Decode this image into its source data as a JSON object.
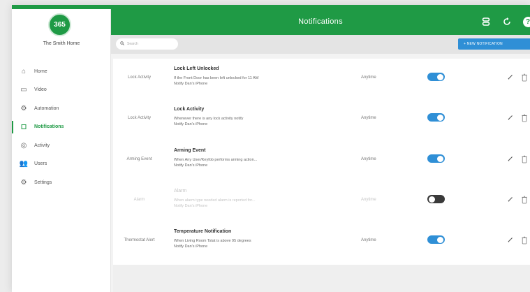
{
  "app": {
    "logo_text": "365",
    "home_name": "The Smith Home"
  },
  "sidebar": {
    "items": [
      {
        "label": "Home",
        "icon": "home-icon",
        "glyph": "⌂"
      },
      {
        "label": "Video",
        "icon": "video-icon",
        "glyph": "▭"
      },
      {
        "label": "Automation",
        "icon": "automation-icon",
        "glyph": "⚙"
      },
      {
        "label": "Notifications",
        "icon": "notifications-icon",
        "glyph": "◻"
      },
      {
        "label": "Activity",
        "icon": "activity-icon",
        "glyph": "◎"
      },
      {
        "label": "Users",
        "icon": "users-icon",
        "glyph": "👥"
      },
      {
        "label": "Settings",
        "icon": "settings-icon",
        "glyph": "⚙"
      }
    ],
    "active": "Notifications"
  },
  "header": {
    "title": "Notifications"
  },
  "toolbar": {
    "search_placeholder": "Search",
    "new_button": "+ NEW NOTIFICATION"
  },
  "notifications": [
    {
      "category": "Lock Activity",
      "title": "Lock Left Unlocked",
      "line1": "If the Front Door has been left unlocked for 11 AM",
      "line2": "Notify Dan's iPhone",
      "when": "Anytime",
      "enabled": true
    },
    {
      "category": "Lock Activity",
      "title": "Lock Activity",
      "line1": "Whenever there is any lock activity notify",
      "line2": "Notify Dan's iPhone",
      "when": "Anytime",
      "enabled": true
    },
    {
      "category": "Arming Event",
      "title": "Arming Event",
      "line1": "When Any User/Keyfob performs arming action...",
      "line2": "Notify Dan's iPhone",
      "when": "Anytime",
      "enabled": true
    },
    {
      "category": "Alarm",
      "title": "Alarm",
      "line1": "When alarm type needed alarm is reported for...",
      "line2": "Notify Dan's iPhone",
      "when": "Anytime",
      "enabled": false
    },
    {
      "category": "Thermostat Alert",
      "title": "Temperature Notification",
      "line1": "When Living Room Tstat is above 95 degrees",
      "line2": "Notify Dan's iPhone",
      "when": "Anytime",
      "enabled": true
    }
  ],
  "colors": {
    "brand_green": "#1f9a45",
    "toggle_on": "#2f8fd6",
    "toggle_off": "#3a3a3a",
    "button_blue": "#2f8fd6"
  }
}
